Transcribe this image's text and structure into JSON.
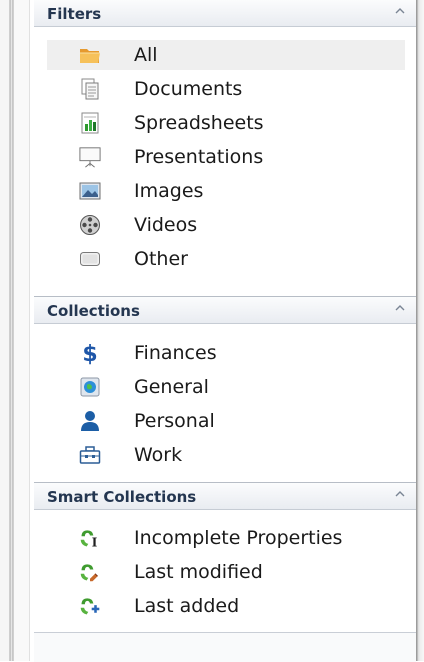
{
  "filters": {
    "title": "Filters",
    "items": [
      {
        "label": "All",
        "icon": "folder-icon",
        "selected": true
      },
      {
        "label": "Documents",
        "icon": "documents-icon"
      },
      {
        "label": "Spreadsheets",
        "icon": "spreadsheet-icon"
      },
      {
        "label": "Presentations",
        "icon": "presentation-icon"
      },
      {
        "label": "Images",
        "icon": "image-icon"
      },
      {
        "label": "Videos",
        "icon": "film-reel-icon"
      },
      {
        "label": "Other",
        "icon": "other-file-icon"
      }
    ]
  },
  "collections": {
    "title": "Collections",
    "items": [
      {
        "label": "Finances",
        "icon": "dollar-icon"
      },
      {
        "label": "General",
        "icon": "globe-icon"
      },
      {
        "label": "Personal",
        "icon": "person-icon"
      },
      {
        "label": "Work",
        "icon": "briefcase-icon"
      }
    ]
  },
  "smart_collections": {
    "title": "Smart Collections",
    "items": [
      {
        "label": "Incomplete Properties",
        "icon": "smart-incomplete-icon"
      },
      {
        "label": "Last modified",
        "icon": "smart-modified-icon"
      },
      {
        "label": "Last added",
        "icon": "smart-added-icon"
      }
    ]
  },
  "colors": {
    "header_text": "#243650",
    "selected_row": "#efefef",
    "dollar_blue": "#1e56a8",
    "person_blue": "#1c5ea6",
    "smart_green": "#3f9b2f"
  }
}
